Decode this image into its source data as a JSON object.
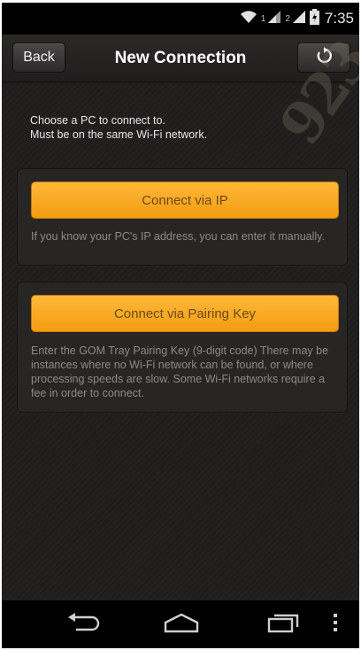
{
  "status_bar": {
    "sim1": "1",
    "sim2": "2",
    "time": "7:35",
    "icons": [
      "wifi-icon",
      "signal-icon",
      "signal-icon",
      "battery-icon"
    ]
  },
  "header": {
    "back_label": "Back",
    "title": "New Connection",
    "refresh_icon": "refresh-icon"
  },
  "intro": {
    "line1": "Choose a PC to connect to.",
    "line2": "Must be on the same Wi-Fi network."
  },
  "connect_ip": {
    "button_label": "Connect via IP",
    "description": "If you know your PC's IP address, you can enter it manually."
  },
  "connect_key": {
    "button_label": "Connect via Pairing Key",
    "description": "Enter the GOM Tray Pairing Key (9-digit code) There may be instances where no Wi-Fi network can be found, or where processing speeds are slow. Some Wi-Fi networks require a fee in order to connect."
  },
  "watermark": "923",
  "nav_bar": {
    "icons": [
      "back-icon",
      "home-icon",
      "recent-apps-icon",
      "overflow-menu-icon"
    ]
  },
  "colors": {
    "accent": "#f7a622",
    "button_text": "#6b4a1a",
    "background": "#1f1e1d"
  }
}
